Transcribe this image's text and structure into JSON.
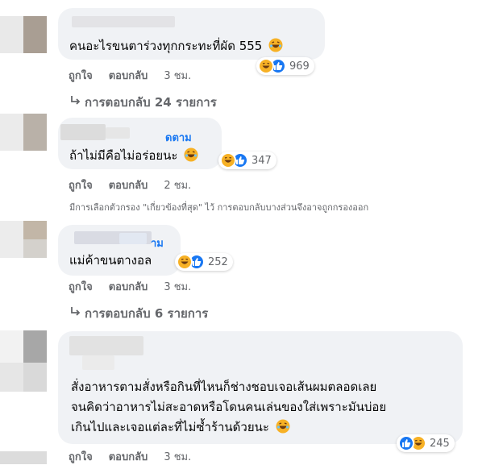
{
  "colors": {
    "bubble": "#f0f2f5",
    "meta": "#65676b",
    "link": "#1877f2",
    "haha": "#f7b125",
    "like": "#1877f2"
  },
  "icons": {
    "reply_arrow": "reply-arrow-icon",
    "laugh": "laughing-emoji-icon",
    "like": "like-thumb-icon"
  },
  "comments": [
    {
      "name_tail": "",
      "text": "คนอะไรขนตาร่วงทุกกระทะที่ผัด 555",
      "reaction_count": "969",
      "like": "ถูกใจ",
      "reply": "ตอบกลับ",
      "time": "3 ชม.",
      "replies_label": "การตอบกลับ 24 รายการ"
    },
    {
      "name_tail": "ดตาม",
      "text": "ถ้าไม่มีคือไม่อร่อยนะ",
      "reaction_count": "347",
      "like": "ถูกใจ",
      "reply": "ตอบกลับ",
      "time": "2 ชม.",
      "filter_note": "มีการเลือกตัวกรอง \"เกี่ยวข้องที่สุด\" ไว้ การตอบกลับบางส่วนจึงอาจถูกกรองออก"
    },
    {
      "name_tail": "าม",
      "text": "แม่ค้าขนตางอล",
      "reaction_count": "252",
      "like": "ถูกใจ",
      "reply": "ตอบกลับ",
      "time": "3 ชม.",
      "replies_label": "การตอบกลับ 6 รายการ"
    },
    {
      "name_tail": "",
      "lines": [
        "สั่งอาหารตามสั่งหรือกินที่ไหนก็ช่างชอบเจอเส้นผมตลอดเลย",
        "จนคิดว่าอาหารไม่สะอาดหรือโดนคนเล่นของใส่เพราะมันบ่อย",
        "เกินไปและเจอแต่ละที่ไม่ซ้ำร้านด้วยนะ"
      ],
      "reaction_count": "245",
      "like": "ถูกใจ",
      "reply": "ตอบกลับ",
      "time": "3 ชม."
    }
  ]
}
